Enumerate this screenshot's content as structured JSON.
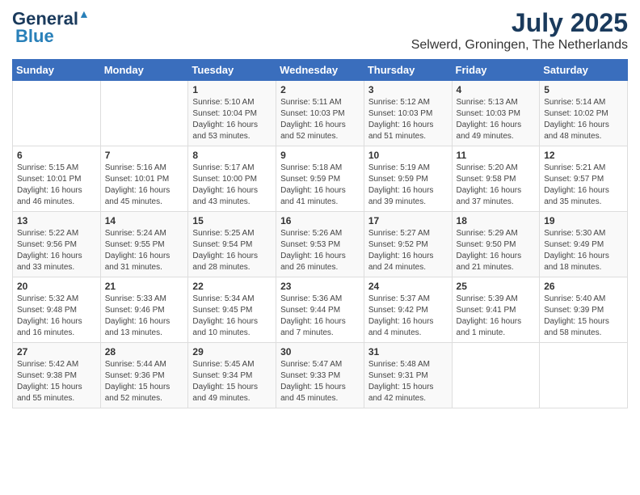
{
  "header": {
    "logo_line1": "General",
    "logo_line2": "Blue",
    "title": "July 2025",
    "subtitle": "Selwerd, Groningen, The Netherlands"
  },
  "days_of_week": [
    "Sunday",
    "Monday",
    "Tuesday",
    "Wednesday",
    "Thursday",
    "Friday",
    "Saturday"
  ],
  "weeks": [
    [
      {
        "day": "",
        "info": ""
      },
      {
        "day": "",
        "info": ""
      },
      {
        "day": "1",
        "info": "Sunrise: 5:10 AM\nSunset: 10:04 PM\nDaylight: 16 hours\nand 53 minutes."
      },
      {
        "day": "2",
        "info": "Sunrise: 5:11 AM\nSunset: 10:03 PM\nDaylight: 16 hours\nand 52 minutes."
      },
      {
        "day": "3",
        "info": "Sunrise: 5:12 AM\nSunset: 10:03 PM\nDaylight: 16 hours\nand 51 minutes."
      },
      {
        "day": "4",
        "info": "Sunrise: 5:13 AM\nSunset: 10:03 PM\nDaylight: 16 hours\nand 49 minutes."
      },
      {
        "day": "5",
        "info": "Sunrise: 5:14 AM\nSunset: 10:02 PM\nDaylight: 16 hours\nand 48 minutes."
      }
    ],
    [
      {
        "day": "6",
        "info": "Sunrise: 5:15 AM\nSunset: 10:01 PM\nDaylight: 16 hours\nand 46 minutes."
      },
      {
        "day": "7",
        "info": "Sunrise: 5:16 AM\nSunset: 10:01 PM\nDaylight: 16 hours\nand 45 minutes."
      },
      {
        "day": "8",
        "info": "Sunrise: 5:17 AM\nSunset: 10:00 PM\nDaylight: 16 hours\nand 43 minutes."
      },
      {
        "day": "9",
        "info": "Sunrise: 5:18 AM\nSunset: 9:59 PM\nDaylight: 16 hours\nand 41 minutes."
      },
      {
        "day": "10",
        "info": "Sunrise: 5:19 AM\nSunset: 9:59 PM\nDaylight: 16 hours\nand 39 minutes."
      },
      {
        "day": "11",
        "info": "Sunrise: 5:20 AM\nSunset: 9:58 PM\nDaylight: 16 hours\nand 37 minutes."
      },
      {
        "day": "12",
        "info": "Sunrise: 5:21 AM\nSunset: 9:57 PM\nDaylight: 16 hours\nand 35 minutes."
      }
    ],
    [
      {
        "day": "13",
        "info": "Sunrise: 5:22 AM\nSunset: 9:56 PM\nDaylight: 16 hours\nand 33 minutes."
      },
      {
        "day": "14",
        "info": "Sunrise: 5:24 AM\nSunset: 9:55 PM\nDaylight: 16 hours\nand 31 minutes."
      },
      {
        "day": "15",
        "info": "Sunrise: 5:25 AM\nSunset: 9:54 PM\nDaylight: 16 hours\nand 28 minutes."
      },
      {
        "day": "16",
        "info": "Sunrise: 5:26 AM\nSunset: 9:53 PM\nDaylight: 16 hours\nand 26 minutes."
      },
      {
        "day": "17",
        "info": "Sunrise: 5:27 AM\nSunset: 9:52 PM\nDaylight: 16 hours\nand 24 minutes."
      },
      {
        "day": "18",
        "info": "Sunrise: 5:29 AM\nSunset: 9:50 PM\nDaylight: 16 hours\nand 21 minutes."
      },
      {
        "day": "19",
        "info": "Sunrise: 5:30 AM\nSunset: 9:49 PM\nDaylight: 16 hours\nand 18 minutes."
      }
    ],
    [
      {
        "day": "20",
        "info": "Sunrise: 5:32 AM\nSunset: 9:48 PM\nDaylight: 16 hours\nand 16 minutes."
      },
      {
        "day": "21",
        "info": "Sunrise: 5:33 AM\nSunset: 9:46 PM\nDaylight: 16 hours\nand 13 minutes."
      },
      {
        "day": "22",
        "info": "Sunrise: 5:34 AM\nSunset: 9:45 PM\nDaylight: 16 hours\nand 10 minutes."
      },
      {
        "day": "23",
        "info": "Sunrise: 5:36 AM\nSunset: 9:44 PM\nDaylight: 16 hours\nand 7 minutes."
      },
      {
        "day": "24",
        "info": "Sunrise: 5:37 AM\nSunset: 9:42 PM\nDaylight: 16 hours\nand 4 minutes."
      },
      {
        "day": "25",
        "info": "Sunrise: 5:39 AM\nSunset: 9:41 PM\nDaylight: 16 hours\nand 1 minute."
      },
      {
        "day": "26",
        "info": "Sunrise: 5:40 AM\nSunset: 9:39 PM\nDaylight: 15 hours\nand 58 minutes."
      }
    ],
    [
      {
        "day": "27",
        "info": "Sunrise: 5:42 AM\nSunset: 9:38 PM\nDaylight: 15 hours\nand 55 minutes."
      },
      {
        "day": "28",
        "info": "Sunrise: 5:44 AM\nSunset: 9:36 PM\nDaylight: 15 hours\nand 52 minutes."
      },
      {
        "day": "29",
        "info": "Sunrise: 5:45 AM\nSunset: 9:34 PM\nDaylight: 15 hours\nand 49 minutes."
      },
      {
        "day": "30",
        "info": "Sunrise: 5:47 AM\nSunset: 9:33 PM\nDaylight: 15 hours\nand 45 minutes."
      },
      {
        "day": "31",
        "info": "Sunrise: 5:48 AM\nSunset: 9:31 PM\nDaylight: 15 hours\nand 42 minutes."
      },
      {
        "day": "",
        "info": ""
      },
      {
        "day": "",
        "info": ""
      }
    ]
  ]
}
